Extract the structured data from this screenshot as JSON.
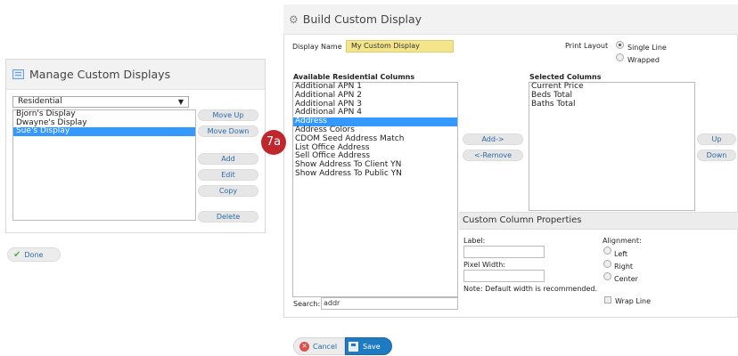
{
  "manage": {
    "title": "Manage Custom Displays",
    "category_selected": "Residential",
    "displays": [
      "Bjorn's Display",
      "Dwayne's Display",
      "Sue's Display"
    ],
    "selected_display": "Sue's Display",
    "buttons": {
      "move_up": "Move Up",
      "move_down": "Move Down",
      "add": "Add",
      "edit": "Edit",
      "copy": "Copy",
      "delete": "Delete"
    },
    "done": "Done"
  },
  "build": {
    "title": "Build Custom Display",
    "display_name_label": "Display Name",
    "display_name_value": "My Custom Display",
    "print_layout_label": "Print Layout",
    "print_layout_options": [
      "Single Line",
      "Wrapped"
    ],
    "print_layout_selected": "Single Line",
    "available_header": "Available Residential Columns",
    "available_columns": [
      "Additional APN 1",
      "Additional APN 2",
      "Additional APN 3",
      "Additional APN 4",
      "Address",
      "Address Colors",
      "CDOM Seed Address Match",
      "List Office Address",
      "Sell Office Address",
      "Show Address To Client YN",
      "Show Address To Public YN"
    ],
    "available_selected": "Address",
    "selected_header": "Selected Columns",
    "selected_columns": [
      "Current Price",
      "Beds Total",
      "Baths Total"
    ],
    "add_button": "Add->",
    "remove_button": "<-Remove",
    "up_button": "Up",
    "down_button": "Down",
    "search_label": "Search:",
    "search_value": "addr",
    "callout": "7a",
    "properties": {
      "header": "Custom Column Properties",
      "label_label": "Label:",
      "pixel_width_label": "Pixel Width:",
      "note": "Note: Default width is recommended.",
      "alignment_label": "Alignment:",
      "alignment_options": [
        "Left",
        "Right",
        "Center"
      ],
      "wrap_line": "Wrap Line"
    },
    "cancel": "Cancel",
    "save": "Save"
  }
}
